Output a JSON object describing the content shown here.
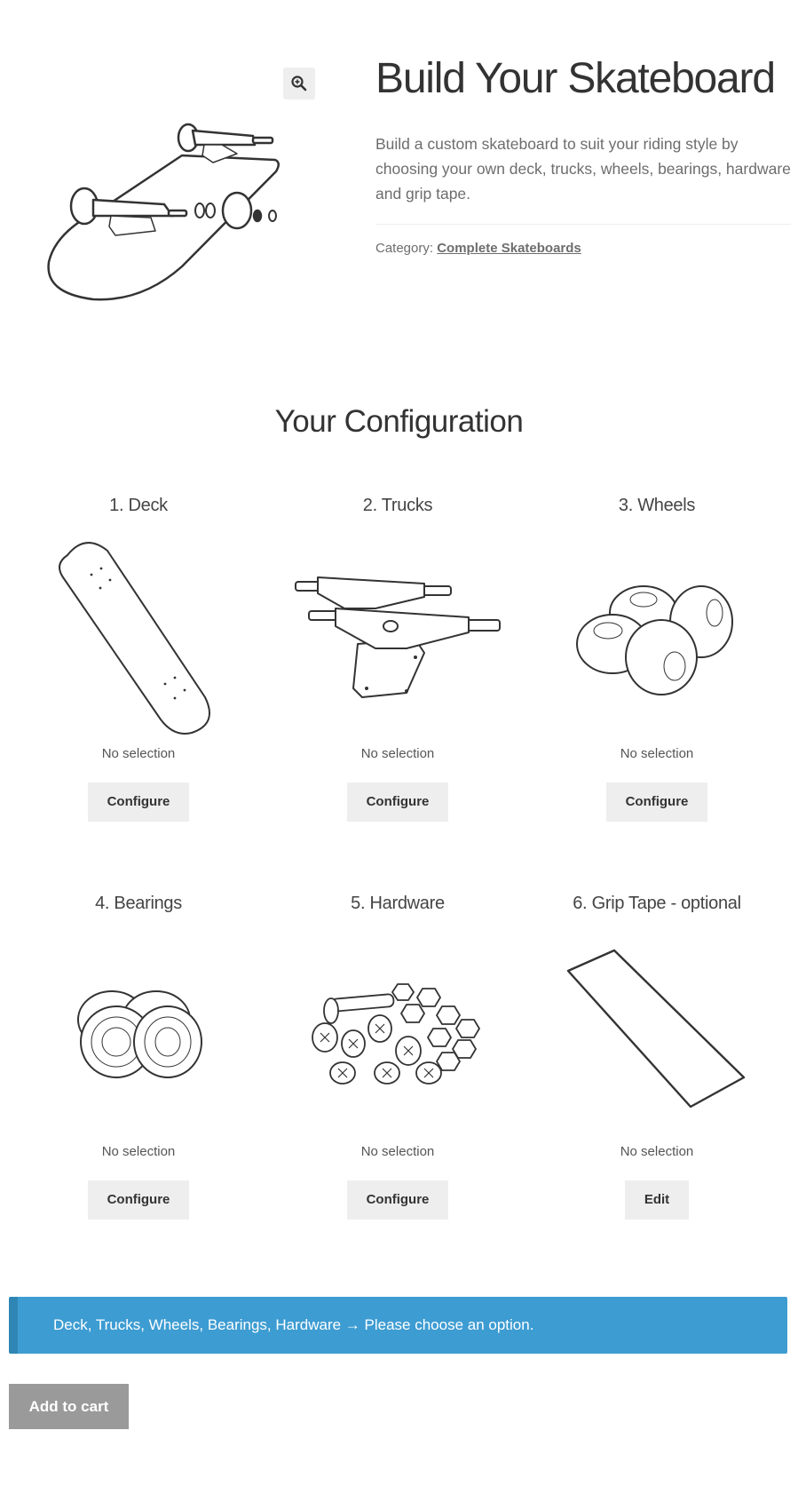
{
  "product": {
    "title": "Build Your Skateboard",
    "description": "Build a custom skateboard to suit your riding style by choosing your own deck, trucks, wheels, bearings, hardware and grip tape.",
    "category_label": "Category:",
    "category_link": "Complete Skateboards"
  },
  "gallery": {
    "zoom_icon": "zoom-in-icon",
    "image": "skateboard-exploded-illustration"
  },
  "configuration": {
    "title": "Your Configuration",
    "components": [
      {
        "title": "1. Deck",
        "image": "deck-illustration",
        "status": "No selection",
        "button": "Configure"
      },
      {
        "title": "2. Trucks",
        "image": "trucks-illustration",
        "status": "No selection",
        "button": "Configure"
      },
      {
        "title": "3. Wheels",
        "image": "wheels-illustration",
        "status": "No selection",
        "button": "Configure"
      },
      {
        "title": "4. Bearings",
        "image": "bearings-illustration",
        "status": "No selection",
        "button": "Configure"
      },
      {
        "title": "5. Hardware",
        "image": "hardware-illustration",
        "status": "No selection",
        "button": "Configure"
      },
      {
        "title": "6. Grip Tape - optional",
        "image": "grip-tape-illustration",
        "status": "No selection",
        "button": "Edit"
      }
    ]
  },
  "notice": {
    "text": "Deck, Trucks, Wheels, Bearings, Hardware → Please choose an option.",
    "color": "#3d9cd2"
  },
  "cart": {
    "add_to_cart_label": "Add to cart",
    "button_color": "#9a9a9a"
  }
}
